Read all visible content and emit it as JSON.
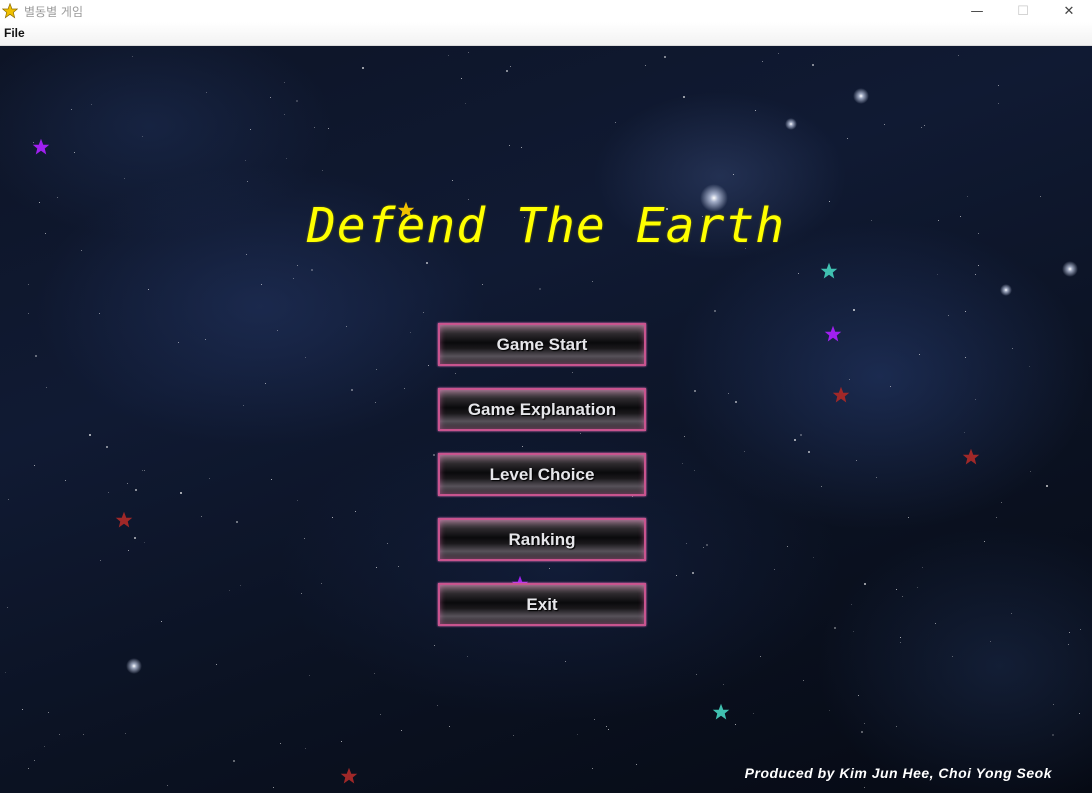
{
  "window": {
    "title": "별동별 게임",
    "icon": "star-icon",
    "controls": {
      "minimize": "—",
      "maximize": "☐",
      "close": "✕"
    }
  },
  "menubar": {
    "file_label": "File"
  },
  "game": {
    "title": "Defend The Earth",
    "title_color": "#ffff00",
    "buttons": {
      "start": "Game Start",
      "explanation": "Game Explanation",
      "level": "Level Choice",
      "ranking": "Ranking",
      "exit": "Exit"
    },
    "credits": "Produced by Kim Jun Hee, Choi Yong Seok"
  },
  "colors": {
    "star_purple": "#a020f0",
    "star_yellow": "#f0c000",
    "star_teal": "#40c0b0",
    "star_red": "#a02828",
    "button_border": "#c8548e"
  }
}
